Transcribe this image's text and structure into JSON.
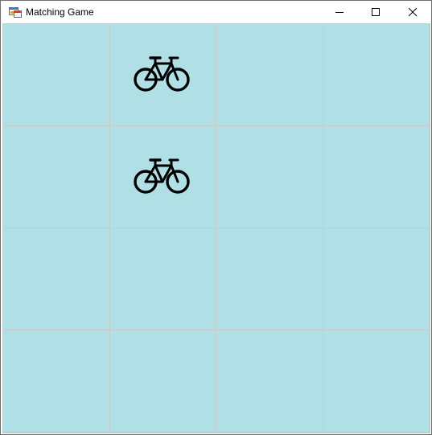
{
  "window": {
    "title": "Matching Game",
    "app_icon": "form-app-icon",
    "controls": [
      {
        "name": "minimize-button",
        "icon": "minimize-icon"
      },
      {
        "name": "maximize-button",
        "icon": "maximize-icon"
      },
      {
        "name": "close-button",
        "icon": "close-icon"
      }
    ]
  },
  "board": {
    "rows": 4,
    "cols": 4,
    "background_color": "#b0dfe5",
    "icon_color": "#000000",
    "cells": [
      [
        {
          "revealed": false,
          "icon": ""
        },
        {
          "revealed": true,
          "icon": "bicycle-icon"
        },
        {
          "revealed": false,
          "icon": ""
        },
        {
          "revealed": false,
          "icon": ""
        }
      ],
      [
        {
          "revealed": false,
          "icon": ""
        },
        {
          "revealed": true,
          "icon": "bicycle-icon"
        },
        {
          "revealed": false,
          "icon": ""
        },
        {
          "revealed": false,
          "icon": ""
        }
      ],
      [
        {
          "revealed": false,
          "icon": ""
        },
        {
          "revealed": false,
          "icon": ""
        },
        {
          "revealed": false,
          "icon": ""
        },
        {
          "revealed": false,
          "icon": ""
        }
      ],
      [
        {
          "revealed": false,
          "icon": ""
        },
        {
          "revealed": false,
          "icon": ""
        },
        {
          "revealed": false,
          "icon": ""
        },
        {
          "revealed": false,
          "icon": ""
        }
      ]
    ]
  }
}
